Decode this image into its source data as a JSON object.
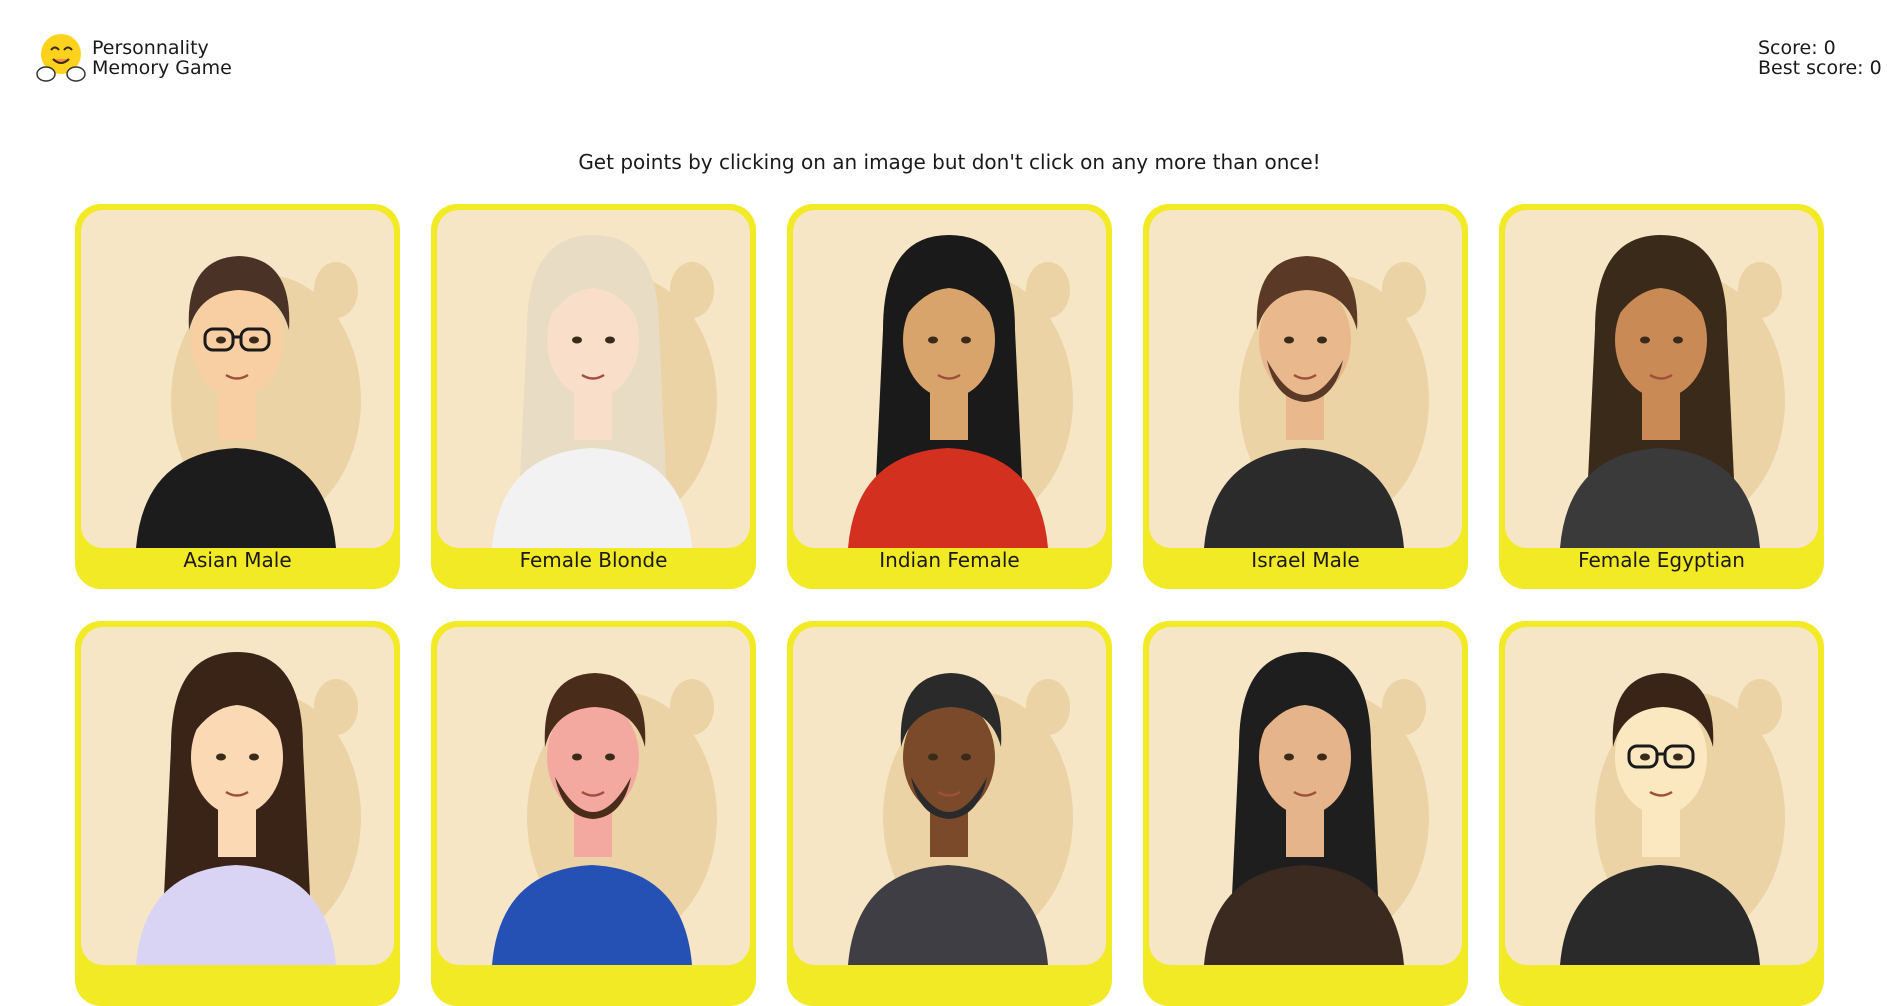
{
  "header": {
    "title_line1": "Personnality",
    "title_line2": "Memory Game",
    "logo_icon": "hugging-face-emoji-icon",
    "score_text": "Score: 0",
    "best_score_text": "Best score: 0"
  },
  "instructions": "Get points by clicking on an image but don't click on any more than once!",
  "cards": [
    {
      "label": "Asian Male",
      "hair": "#4a3326",
      "skin": "#f7cfa3",
      "shirt": "#1c1c1c",
      "glasses": true,
      "beard": false,
      "long_hair": false
    },
    {
      "label": "Female Blonde",
      "hair": "#e8dcc4",
      "skin": "#f9dfc9",
      "shirt": "#f2f2f2",
      "glasses": false,
      "beard": false,
      "long_hair": true
    },
    {
      "label": "Indian Female",
      "hair": "#1a1a1a",
      "skin": "#d9a36c",
      "shirt": "#d33020",
      "glasses": false,
      "beard": false,
      "long_hair": true
    },
    {
      "label": "Israel Male",
      "hair": "#5a3a26",
      "skin": "#e9b88c",
      "shirt": "#2b2b2b",
      "glasses": false,
      "beard": true,
      "long_hair": false
    },
    {
      "label": "Female Egyptian",
      "hair": "#3a2a1a",
      "skin": "#c98a56",
      "shirt": "#3a3a3a",
      "glasses": false,
      "beard": false,
      "long_hair": true
    },
    {
      "label": "",
      "hair": "#3a2418",
      "skin": "#fbd9b5",
      "shirt": "#d9d4f4",
      "glasses": false,
      "beard": false,
      "long_hair": true
    },
    {
      "label": "",
      "hair": "#4a2c1a",
      "skin": "#f4a9a0",
      "shirt": "#2451b3",
      "glasses": false,
      "beard": true,
      "long_hair": false
    },
    {
      "label": "",
      "hair": "#2a2a2a",
      "skin": "#7a4a2a",
      "shirt": "#3e3e44",
      "glasses": false,
      "beard": true,
      "long_hair": false
    },
    {
      "label": "",
      "hair": "#1e1e1e",
      "skin": "#e6b48a",
      "shirt": "#3a2a20",
      "glasses": false,
      "beard": false,
      "long_hair": true
    },
    {
      "label": "",
      "hair": "#3a2418",
      "skin": "#fbe8c0",
      "shirt": "#2a2a2a",
      "glasses": true,
      "beard": false,
      "long_hair": false
    }
  ],
  "colors": {
    "card_bg": "#f2ea25",
    "portrait_bg": "#f6e6c6",
    "blob": "#ecd3a6"
  }
}
